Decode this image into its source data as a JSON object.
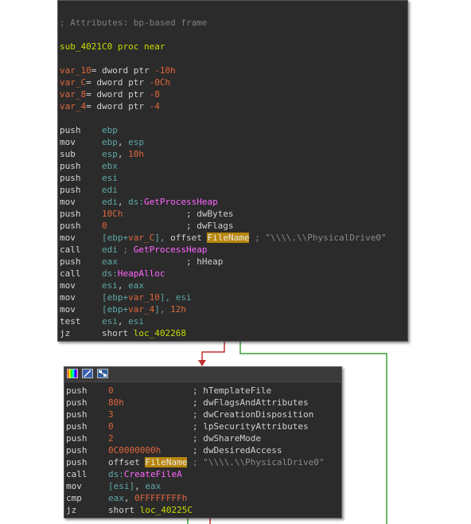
{
  "node1": {
    "lines": [
      {
        "parts": [
          {
            "t": "; Attributes: bp-based frame",
            "c": "comment"
          }
        ]
      },
      {
        "parts": []
      },
      {
        "parts": [
          {
            "t": "sub_4021C0 proc near",
            "c": "label"
          }
        ]
      },
      {
        "parts": []
      },
      {
        "parts": [
          {
            "t": "var_10",
            "c": "var"
          },
          {
            "t": "= dword ptr ",
            "c": "plain"
          },
          {
            "t": "-10h",
            "c": "num"
          }
        ]
      },
      {
        "parts": [
          {
            "t": "var_C",
            "c": "var"
          },
          {
            "t": "= dword ptr ",
            "c": "plain"
          },
          {
            "t": "-0Ch",
            "c": "num"
          }
        ]
      },
      {
        "parts": [
          {
            "t": "var_8",
            "c": "var"
          },
          {
            "t": "= dword ptr ",
            "c": "plain"
          },
          {
            "t": "-8",
            "c": "num"
          }
        ]
      },
      {
        "parts": [
          {
            "t": "var_4",
            "c": "var"
          },
          {
            "t": "= dword ptr ",
            "c": "plain"
          },
          {
            "t": "-4",
            "c": "num"
          }
        ]
      },
      {
        "parts": []
      },
      {
        "parts": [
          {
            "t": "push    ",
            "c": "mnem"
          },
          {
            "t": "ebp",
            "c": "reg"
          }
        ]
      },
      {
        "parts": [
          {
            "t": "mov     ",
            "c": "mnem"
          },
          {
            "t": "ebp",
            "c": "reg"
          },
          {
            "t": ", ",
            "c": "plain"
          },
          {
            "t": "esp",
            "c": "reg"
          }
        ]
      },
      {
        "parts": [
          {
            "t": "sub     ",
            "c": "mnem"
          },
          {
            "t": "esp",
            "c": "reg"
          },
          {
            "t": ", ",
            "c": "plain"
          },
          {
            "t": "10h",
            "c": "num"
          }
        ]
      },
      {
        "parts": [
          {
            "t": "push    ",
            "c": "mnem"
          },
          {
            "t": "ebx",
            "c": "reg"
          }
        ]
      },
      {
        "parts": [
          {
            "t": "push    ",
            "c": "mnem"
          },
          {
            "t": "esi",
            "c": "reg"
          }
        ]
      },
      {
        "parts": [
          {
            "t": "push    ",
            "c": "mnem"
          },
          {
            "t": "edi",
            "c": "reg"
          }
        ]
      },
      {
        "parts": [
          {
            "t": "mov     ",
            "c": "mnem"
          },
          {
            "t": "edi",
            "c": "reg"
          },
          {
            "t": ", ",
            "c": "plain"
          },
          {
            "t": "ds:",
            "c": "reg"
          },
          {
            "t": "GetProcessHeap",
            "c": "api"
          }
        ]
      },
      {
        "parts": [
          {
            "t": "push    ",
            "c": "mnem"
          },
          {
            "t": "10Ch",
            "c": "num"
          },
          {
            "t": "            ; dwBytes",
            "c": "plain"
          }
        ]
      },
      {
        "parts": [
          {
            "t": "push    ",
            "c": "mnem"
          },
          {
            "t": "0",
            "c": "num"
          },
          {
            "t": "               ; dwFlags",
            "c": "plain"
          }
        ]
      },
      {
        "parts": [
          {
            "t": "mov     ",
            "c": "mnem"
          },
          {
            "t": "[ebp+",
            "c": "reg"
          },
          {
            "t": "var_C",
            "c": "var"
          },
          {
            "t": "], ",
            "c": "reg"
          },
          {
            "t": "offset ",
            "c": "plain"
          },
          {
            "t": "FileName",
            "c": "hl"
          },
          {
            "t": " ; \"\\\\\\\\.\\\\PhysicalDrive0\"",
            "c": "str"
          }
        ]
      },
      {
        "parts": [
          {
            "t": "call    ",
            "c": "mnem"
          },
          {
            "t": "edi",
            "c": "reg"
          },
          {
            "t": " ; ",
            "c": "comment"
          },
          {
            "t": "GetProcessHeap",
            "c": "api"
          }
        ]
      },
      {
        "parts": [
          {
            "t": "push    ",
            "c": "mnem"
          },
          {
            "t": "eax",
            "c": "reg"
          },
          {
            "t": "             ; hHeap",
            "c": "plain"
          }
        ]
      },
      {
        "parts": [
          {
            "t": "call    ",
            "c": "mnem"
          },
          {
            "t": "ds:",
            "c": "reg"
          },
          {
            "t": "HeapAlloc",
            "c": "api"
          }
        ]
      },
      {
        "parts": [
          {
            "t": "mov     ",
            "c": "mnem"
          },
          {
            "t": "esi",
            "c": "reg"
          },
          {
            "t": ", ",
            "c": "plain"
          },
          {
            "t": "eax",
            "c": "reg"
          }
        ]
      },
      {
        "parts": [
          {
            "t": "mov     ",
            "c": "mnem"
          },
          {
            "t": "[ebp+",
            "c": "reg"
          },
          {
            "t": "var_10",
            "c": "var"
          },
          {
            "t": "], ",
            "c": "reg"
          },
          {
            "t": "esi",
            "c": "reg"
          }
        ]
      },
      {
        "parts": [
          {
            "t": "mov     ",
            "c": "mnem"
          },
          {
            "t": "[ebp+",
            "c": "reg"
          },
          {
            "t": "var_4",
            "c": "var"
          },
          {
            "t": "], ",
            "c": "reg"
          },
          {
            "t": "12h",
            "c": "num"
          }
        ]
      },
      {
        "parts": [
          {
            "t": "test    ",
            "c": "mnem"
          },
          {
            "t": "esi",
            "c": "reg"
          },
          {
            "t": ", ",
            "c": "plain"
          },
          {
            "t": "esi",
            "c": "reg"
          }
        ]
      },
      {
        "parts": [
          {
            "t": "jz      ",
            "c": "mnem"
          },
          {
            "t": "short ",
            "c": "plain"
          },
          {
            "t": "loc_402268",
            "c": "label"
          }
        ]
      }
    ]
  },
  "node2": {
    "toolbar_icons": [
      "color-palette-icon",
      "edit-pencil-icon",
      "graph-view-icon"
    ],
    "lines": [
      {
        "parts": [
          {
            "t": "push    ",
            "c": "mnem"
          },
          {
            "t": "0",
            "c": "num"
          },
          {
            "t": "               ; hTemplateFile",
            "c": "plain"
          }
        ]
      },
      {
        "parts": [
          {
            "t": "push    ",
            "c": "mnem"
          },
          {
            "t": "80h",
            "c": "num"
          },
          {
            "t": "             ; dwFlagsAndAttributes",
            "c": "plain"
          }
        ]
      },
      {
        "parts": [
          {
            "t": "push    ",
            "c": "mnem"
          },
          {
            "t": "3",
            "c": "num"
          },
          {
            "t": "               ; dwCreationDisposition",
            "c": "plain"
          }
        ]
      },
      {
        "parts": [
          {
            "t": "push    ",
            "c": "mnem"
          },
          {
            "t": "0",
            "c": "num"
          },
          {
            "t": "               ; lpSecurityAttributes",
            "c": "plain"
          }
        ]
      },
      {
        "parts": [
          {
            "t": "push    ",
            "c": "mnem"
          },
          {
            "t": "2",
            "c": "num"
          },
          {
            "t": "               ; dwShareMode",
            "c": "plain"
          }
        ]
      },
      {
        "parts": [
          {
            "t": "push    ",
            "c": "mnem"
          },
          {
            "t": "0C0000000h",
            "c": "num"
          },
          {
            "t": "      ; dwDesiredAccess",
            "c": "plain"
          }
        ]
      },
      {
        "parts": [
          {
            "t": "push    ",
            "c": "mnem"
          },
          {
            "t": "offset ",
            "c": "plain"
          },
          {
            "t": "FileName",
            "c": "hl"
          },
          {
            "t": " ; \"\\\\\\\\.\\\\PhysicalDrive0\"",
            "c": "str"
          }
        ]
      },
      {
        "parts": [
          {
            "t": "call    ",
            "c": "mnem"
          },
          {
            "t": "ds:",
            "c": "reg"
          },
          {
            "t": "CreateFileA",
            "c": "api"
          }
        ]
      },
      {
        "parts": [
          {
            "t": "mov     ",
            "c": "mnem"
          },
          {
            "t": "[esi]",
            "c": "reg"
          },
          {
            "t": ", ",
            "c": "plain"
          },
          {
            "t": "eax",
            "c": "reg"
          }
        ]
      },
      {
        "parts": [
          {
            "t": "cmp     ",
            "c": "mnem"
          },
          {
            "t": "eax",
            "c": "reg"
          },
          {
            "t": ", ",
            "c": "plain"
          },
          {
            "t": "0FFFFFFFFh",
            "c": "num"
          }
        ]
      },
      {
        "parts": [
          {
            "t": "jz      ",
            "c": "mnem"
          },
          {
            "t": "short ",
            "c": "plain"
          },
          {
            "t": "loc_40225C",
            "c": "label"
          }
        ]
      }
    ]
  },
  "edges": {
    "false_color": "#c03030",
    "true_color": "#3aa03a"
  }
}
